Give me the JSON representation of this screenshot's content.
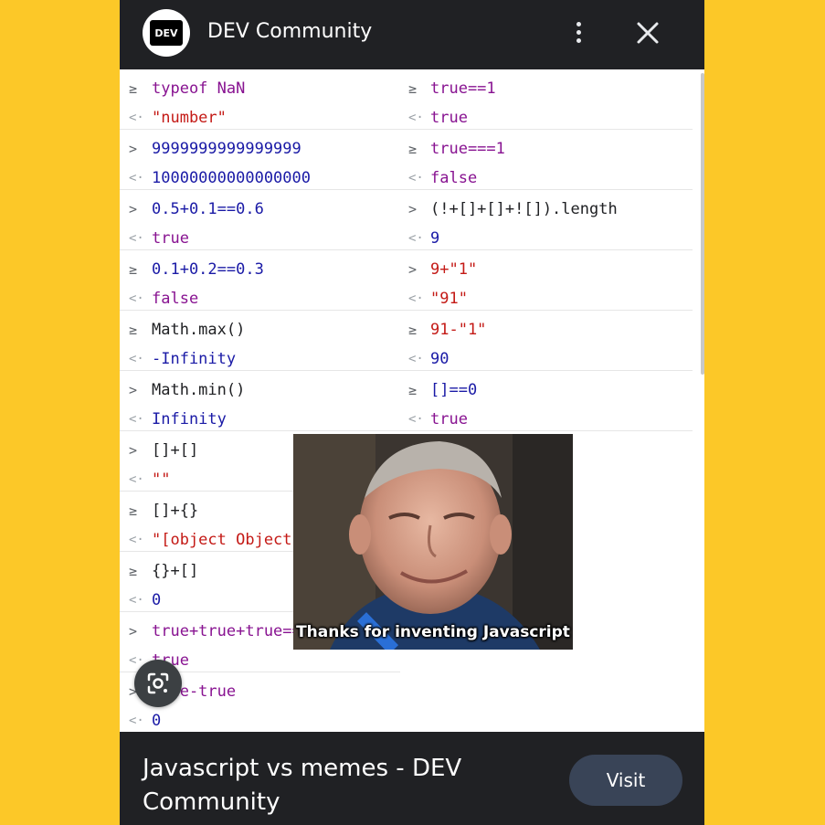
{
  "header": {
    "logo_text": "DEV",
    "site_name": "DEV Community",
    "more_icon": "more-vert-icon",
    "close_icon": "close-icon"
  },
  "colors": {
    "background": "#fcc828",
    "bar": "#202124",
    "keyword_purple": "#881391",
    "number_blue": "#1a1aa6",
    "string_red": "#c41a16",
    "plain": "#202124"
  },
  "console": {
    "left": [
      {
        "in_prompt": "≥",
        "in": [
          {
            "t": "typeof NaN",
            "c": "#881391"
          }
        ],
        "out": [
          {
            "t": "\"number\"",
            "c": "#c41a16"
          }
        ]
      },
      {
        "in_prompt": ">",
        "in": [
          {
            "t": "9999999999999999",
            "c": "#1a1aa6"
          }
        ],
        "out": [
          {
            "t": "10000000000000000",
            "c": "#1a1aa6"
          }
        ]
      },
      {
        "in_prompt": ">",
        "in": [
          {
            "t": "0.5+0.1==0.6",
            "c": "#1a1aa6"
          }
        ],
        "out": [
          {
            "t": "true",
            "c": "#881391"
          }
        ]
      },
      {
        "in_prompt": "≥",
        "in": [
          {
            "t": "0.1+0.2==0.3",
            "c": "#1a1aa6"
          }
        ],
        "out": [
          {
            "t": "false",
            "c": "#881391"
          }
        ]
      },
      {
        "in_prompt": "≥",
        "in": [
          {
            "t": "Math.max()",
            "c": "#202124"
          }
        ],
        "out": [
          {
            "t": "-Infinity",
            "c": "#1a1aa6"
          }
        ]
      },
      {
        "in_prompt": ">",
        "in": [
          {
            "t": "Math.min()",
            "c": "#202124"
          }
        ],
        "out": [
          {
            "t": "Infinity",
            "c": "#1a1aa6"
          }
        ]
      },
      {
        "in_prompt": ">",
        "in": [
          {
            "t": "[]+[]",
            "c": "#202124"
          }
        ],
        "out": [
          {
            "t": "\"\"",
            "c": "#c41a16"
          }
        ]
      },
      {
        "in_prompt": "≥",
        "in": [
          {
            "t": "[]+{}",
            "c": "#202124"
          }
        ],
        "out": [
          {
            "t": "\"[object Object]\"",
            "c": "#c41a16"
          }
        ]
      },
      {
        "in_prompt": "≥",
        "in": [
          {
            "t": "{}+[]",
            "c": "#202124"
          }
        ],
        "out": [
          {
            "t": "0",
            "c": "#1a1aa6"
          }
        ]
      },
      {
        "in_prompt": ">",
        "in": [
          {
            "t": "true+true+true===3",
            "c": "#881391"
          }
        ],
        "out": [
          {
            "t": "true",
            "c": "#881391"
          }
        ]
      },
      {
        "in_prompt": ">",
        "in": [
          {
            "t": "true-true",
            "c": "#881391"
          }
        ],
        "out": [
          {
            "t": "0",
            "c": "#1a1aa6"
          }
        ]
      }
    ],
    "right": [
      {
        "in_prompt": "≥",
        "in": [
          {
            "t": "true==1",
            "c": "#881391"
          }
        ],
        "out": [
          {
            "t": "true",
            "c": "#881391"
          }
        ]
      },
      {
        "in_prompt": "≥",
        "in": [
          {
            "t": "true===1",
            "c": "#881391"
          }
        ],
        "out": [
          {
            "t": "false",
            "c": "#881391"
          }
        ]
      },
      {
        "in_prompt": ">",
        "in": [
          {
            "t": "(!+[]+[]+![]).length",
            "c": "#202124"
          }
        ],
        "out": [
          {
            "t": "9",
            "c": "#1a1aa6"
          }
        ]
      },
      {
        "in_prompt": ">",
        "in": [
          {
            "t": "9+\"1\"",
            "c": "#c41a16"
          }
        ],
        "out": [
          {
            "t": "\"91\"",
            "c": "#c41a16"
          }
        ]
      },
      {
        "in_prompt": "≥",
        "in": [
          {
            "t": "91-\"1\"",
            "c": "#c41a16"
          }
        ],
        "out": [
          {
            "t": "90",
            "c": "#1a1aa6"
          }
        ]
      },
      {
        "in_prompt": "≥",
        "in": [
          {
            "t": "[]==0",
            "c": "#1a1aa6"
          }
        ],
        "out": [
          {
            "t": "true",
            "c": "#881391"
          }
        ]
      }
    ],
    "out_prompt": "<·"
  },
  "meme": {
    "caption": "Thanks for inventing Javascript"
  },
  "lens_icon": "google-lens-icon",
  "footer": {
    "title": "Javascript vs memes - DEV Community",
    "visit_label": "Visit"
  }
}
